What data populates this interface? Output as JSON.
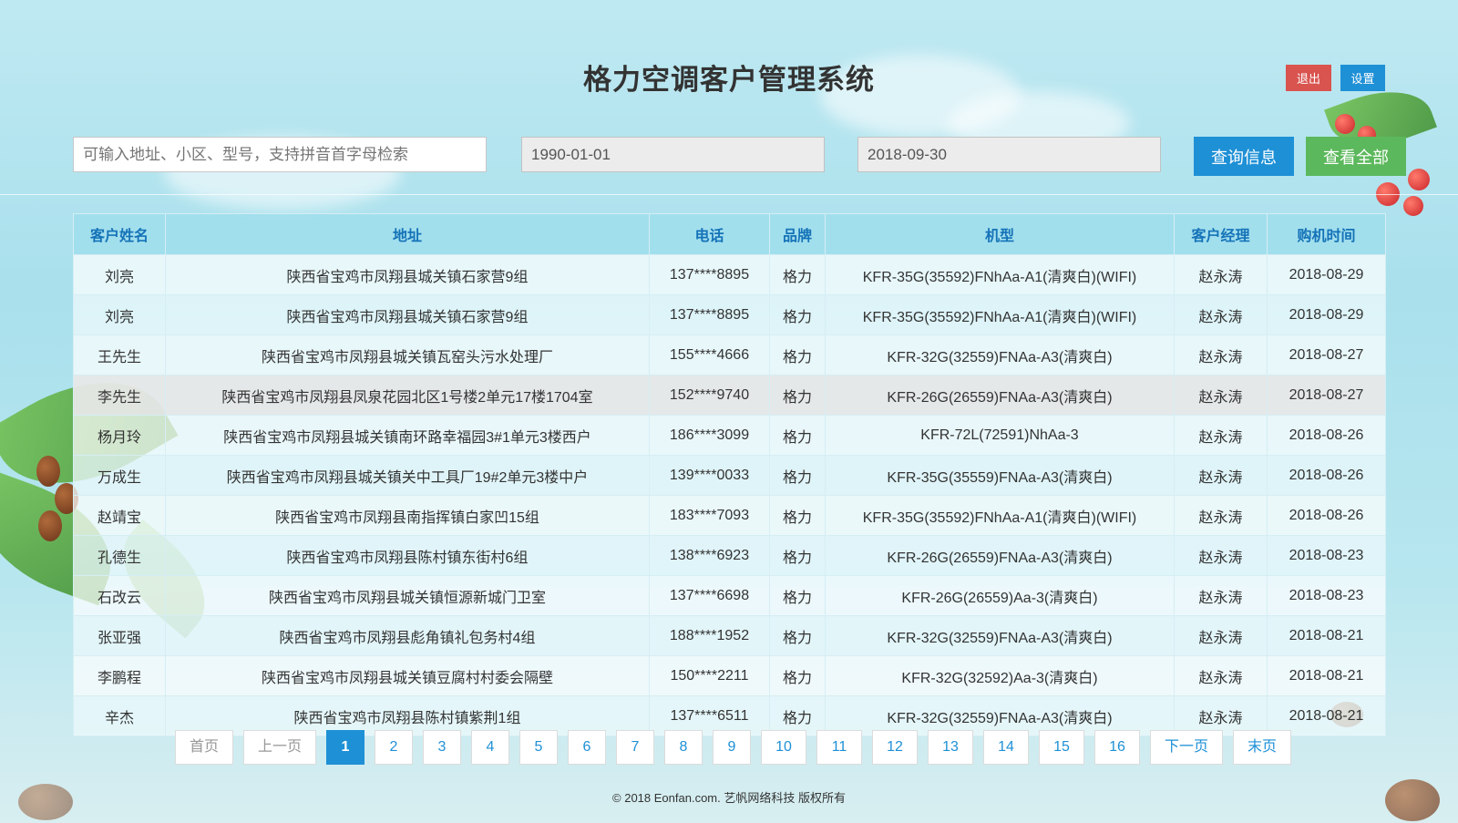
{
  "header": {
    "title": "格力空调客户管理系统",
    "exit_label": "退出",
    "settings_label": "设置"
  },
  "search": {
    "placeholder": "可输入地址、小区、型号，支持拼音首字母检索",
    "start_date": "1990-01-01",
    "end_date": "2018-09-30",
    "query_label": "查询信息",
    "all_label": "查看全部"
  },
  "table": {
    "columns": [
      "客户姓名",
      "地址",
      "电话",
      "品牌",
      "机型",
      "客户经理",
      "购机时间"
    ],
    "rows": [
      [
        "刘亮",
        "陕西省宝鸡市凤翔县城关镇石家营9组",
        "137****8895",
        "格力",
        "KFR-35G(35592)FNhAa-A1(清爽白)(WIFI)",
        "赵永涛",
        "2018-08-29"
      ],
      [
        "刘亮",
        "陕西省宝鸡市凤翔县城关镇石家营9组",
        "137****8895",
        "格力",
        "KFR-35G(35592)FNhAa-A1(清爽白)(WIFI)",
        "赵永涛",
        "2018-08-29"
      ],
      [
        "王先生",
        "陕西省宝鸡市凤翔县城关镇瓦窑头污水处理厂",
        "155****4666",
        "格力",
        "KFR-32G(32559)FNAa-A3(清爽白)",
        "赵永涛",
        "2018-08-27"
      ],
      [
        "李先生",
        "陕西省宝鸡市凤翔县凤泉花园北区1号楼2单元17楼1704室",
        "152****9740",
        "格力",
        "KFR-26G(26559)FNAa-A3(清爽白)",
        "赵永涛",
        "2018-08-27"
      ],
      [
        "杨月玲",
        "陕西省宝鸡市凤翔县城关镇南环路幸福园3#1单元3楼西户",
        "186****3099",
        "格力",
        "KFR-72L(72591)NhAa-3",
        "赵永涛",
        "2018-08-26"
      ],
      [
        "万成生",
        "陕西省宝鸡市凤翔县城关镇关中工具厂19#2单元3楼中户",
        "139****0033",
        "格力",
        "KFR-35G(35559)FNAa-A3(清爽白)",
        "赵永涛",
        "2018-08-26"
      ],
      [
        "赵靖宝",
        "陕西省宝鸡市凤翔县南指挥镇白家凹15组",
        "183****7093",
        "格力",
        "KFR-35G(35592)FNhAa-A1(清爽白)(WIFI)",
        "赵永涛",
        "2018-08-26"
      ],
      [
        "孔德生",
        "陕西省宝鸡市凤翔县陈村镇东街村6组",
        "138****6923",
        "格力",
        "KFR-26G(26559)FNAa-A3(清爽白)",
        "赵永涛",
        "2018-08-23"
      ],
      [
        "石改云",
        "陕西省宝鸡市凤翔县城关镇恒源新城门卫室",
        "137****6698",
        "格力",
        "KFR-26G(26559)Aa-3(清爽白)",
        "赵永涛",
        "2018-08-23"
      ],
      [
        "张亚强",
        "陕西省宝鸡市凤翔县彪角镇礼包务村4组",
        "188****1952",
        "格力",
        "KFR-32G(32559)FNAa-A3(清爽白)",
        "赵永涛",
        "2018-08-21"
      ],
      [
        "李鹏程",
        "陕西省宝鸡市凤翔县城关镇豆腐村村委会隔壁",
        "150****2211",
        "格力",
        "KFR-32G(32592)Aa-3(清爽白)",
        "赵永涛",
        "2018-08-21"
      ],
      [
        "辛杰",
        "陕西省宝鸡市凤翔县陈村镇紫荆1组",
        "137****6511",
        "格力",
        "KFR-32G(32559)FNAa-A3(清爽白)",
        "赵永涛",
        "2018-08-21"
      ]
    ]
  },
  "pager": {
    "first": "首页",
    "prev": "上一页",
    "pages": [
      "1",
      "2",
      "3",
      "4",
      "5",
      "6",
      "7",
      "8",
      "9",
      "10",
      "11",
      "12",
      "13",
      "14",
      "15",
      "16"
    ],
    "current": "1",
    "next": "下一页",
    "last": "末页"
  },
  "footer": {
    "text": "© 2018 Eonfan.com. 艺帆网络科技 版权所有"
  },
  "colors": {
    "primary": "#1e90d6",
    "danger": "#d9534f",
    "success": "#5cb85c",
    "header_text": "#1573b8"
  }
}
